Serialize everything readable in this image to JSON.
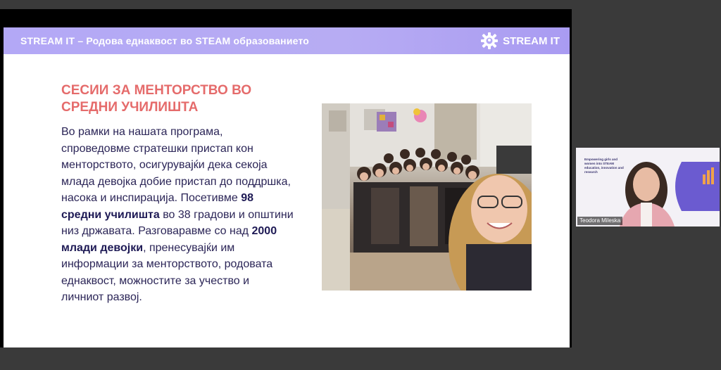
{
  "slide": {
    "banner_title": "STREAM IT – Родова еднаквост во STEAM образованието",
    "brand_name": "STREAM IT",
    "heading_line1": "СЕСИИ ЗА МЕНТОРСТВО ВО",
    "heading_line2": "СРЕДНИ УЧИЛИШТА",
    "body": {
      "p1": "Во рамки на нашата програма, спроведовме стратешки пристап кон менторството, осигурувајќи дека секоја млада девојка добие пристап до поддршка, насока и инспирација. Посетивме ",
      "b1": "98 средни училишта",
      "p2": " во 38 градови и општини низ државата. Разговаравме со над ",
      "b2": "2000 млади девојки",
      "p3": ", пренесувајќи им информации за менторството, родовата еднаквост, можностите за учество и личниот развој."
    },
    "photo_icon": "group-photo-icon"
  },
  "participant": {
    "name": "Teodora Mileska",
    "tiny_text": "Empowering girls and women into STEAM education, innovation and research"
  },
  "colors": {
    "banner": "#b3a8f6",
    "heading": "#e56b6b",
    "body": "#2b2557"
  }
}
